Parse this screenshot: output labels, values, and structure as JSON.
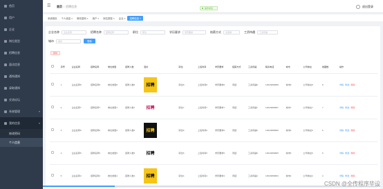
{
  "sidebar": {
    "items": [
      {
        "label": "首页",
        "active": false
      },
      {
        "label": "用户",
        "active": false
      },
      {
        "label": "企业",
        "active": false
      },
      {
        "label": "岗位类型",
        "active": false
      },
      {
        "label": "招聘信息",
        "active": false
      },
      {
        "label": "面试信息",
        "active": false
      },
      {
        "label": "通知通知",
        "active": false
      },
      {
        "label": "录取通知",
        "active": false
      },
      {
        "label": "交流论坛",
        "active": false
      },
      {
        "label": "系统管理",
        "active": false
      },
      {
        "label": "我的信息",
        "active": true
      }
    ],
    "subitems": [
      {
        "label": "修改密码",
        "active": false
      },
      {
        "label": "个人信息",
        "active": true
      }
    ]
  },
  "topbar": {
    "breadcrumb_home": "首页",
    "breadcrumb_current": "招聘信息",
    "toast": "操作成功",
    "logout": "退出登录"
  },
  "tabs": [
    {
      "label": "系统首页",
      "active": false
    },
    {
      "label": "个人信息 ×",
      "active": false
    },
    {
      "label": "修改密码 ×",
      "active": false
    },
    {
      "label": "用户 ×",
      "active": false
    },
    {
      "label": "岗位类型 ×",
      "active": false
    },
    {
      "label": "企业 ×",
      "active": false
    },
    {
      "label": "招聘信息 ×",
      "active": true
    }
  ],
  "filters": {
    "row1": [
      {
        "label": "企业名称",
        "placeholder": "企业名称"
      },
      {
        "label": "招聘名称",
        "placeholder": "招聘名称"
      },
      {
        "label": "职位",
        "placeholder": "职位"
      },
      {
        "label": "学历要求",
        "placeholder": "学历要求"
      },
      {
        "label": "结薪方式",
        "placeholder": "请选择"
      },
      {
        "label": "工资待遇",
        "placeholder": "工资待遇"
      }
    ],
    "row2": [
      {
        "label": "城市",
        "placeholder": "城市"
      }
    ],
    "search_button": "搜索",
    "delete_button": "删除"
  },
  "table": {
    "headers": [
      "",
      "序号",
      "企业名称",
      "招聘名称",
      "岗位类型",
      "招聘人数",
      "图片",
      "职位",
      "上班时间",
      "学历要求",
      "结薪方式",
      "工资待遇",
      "联系电话",
      "城市",
      "公司地址",
      "收藏数",
      "操作"
    ],
    "actions": {
      "view": "详情",
      "edit": "修改",
      "delete": "删除"
    },
    "rows": [
      {
        "idx": "1",
        "company": "企业名称8",
        "title": "招聘名称8",
        "type": "岗位类型8",
        "count": "招聘人数8",
        "pos": "职位8",
        "time": "上班时间8",
        "edu": "学历要求8",
        "pay": "周结",
        "salary": "工资待遇8",
        "phone": "13823888888",
        "city": "城市8",
        "addr": "公司地址8",
        "fav": "8"
      },
      {
        "idx": "2",
        "company": "企业名称7",
        "title": "招聘名称7",
        "type": "岗位类型7",
        "count": "招聘人数7",
        "pos": "职位7",
        "time": "上班时间7",
        "edu": "学历要求7",
        "pay": "周结",
        "salary": "工资待遇7",
        "phone": "13823888887",
        "city": "城市7",
        "addr": "公司地址7",
        "fav": "7"
      },
      {
        "idx": "3",
        "company": "企业名称6",
        "title": "招聘名称6",
        "type": "岗位类型6",
        "count": "招聘人数6",
        "pos": "职位6",
        "time": "上班时间6",
        "edu": "学历要求6",
        "pay": "周结",
        "salary": "工资待遇6",
        "phone": "13823888886",
        "city": "城市6",
        "addr": "公司地址6",
        "fav": "6"
      },
      {
        "idx": "4",
        "company": "企业名称5",
        "title": "招聘名称5",
        "type": "岗位类型5",
        "count": "招聘人数5",
        "pos": "职位5",
        "time": "上班时间5",
        "edu": "学历要求5",
        "pay": "周结",
        "salary": "工资待遇5",
        "phone": "13823888885",
        "city": "城市5",
        "addr": "公司地址5",
        "fav": "5"
      },
      {
        "idx": "5",
        "company": "企业名称4",
        "title": "招聘名称4",
        "type": "岗位类型4",
        "count": "招聘人数4",
        "pos": "职位4",
        "time": "上班时间4",
        "edu": "学历要求4",
        "pay": "周结",
        "salary": "工资待遇4",
        "phone": "13823888884",
        "city": "城市4",
        "addr": "公司地址4",
        "fav": "4"
      }
    ]
  },
  "thumb_images": [
    {
      "text": "招聘",
      "bg": "#f5c518",
      "fg": "#111"
    },
    {
      "text": "招聘",
      "bg": "#ffffff",
      "fg": "#c2185b"
    },
    {
      "text": "招聘",
      "bg": "#111111",
      "fg": "#f5c518"
    },
    {
      "text": "招聘",
      "bg": "#ffffff",
      "fg": "#111"
    },
    {
      "text": "招聘",
      "bg": "#f5c518",
      "fg": "#111"
    }
  ],
  "watermark": "CSDN @全传程序毕设",
  "colors": {
    "sidebar": "#2f3a4a",
    "primary": "#409eff",
    "danger": "#f56c6c",
    "success": "#67c23a"
  }
}
